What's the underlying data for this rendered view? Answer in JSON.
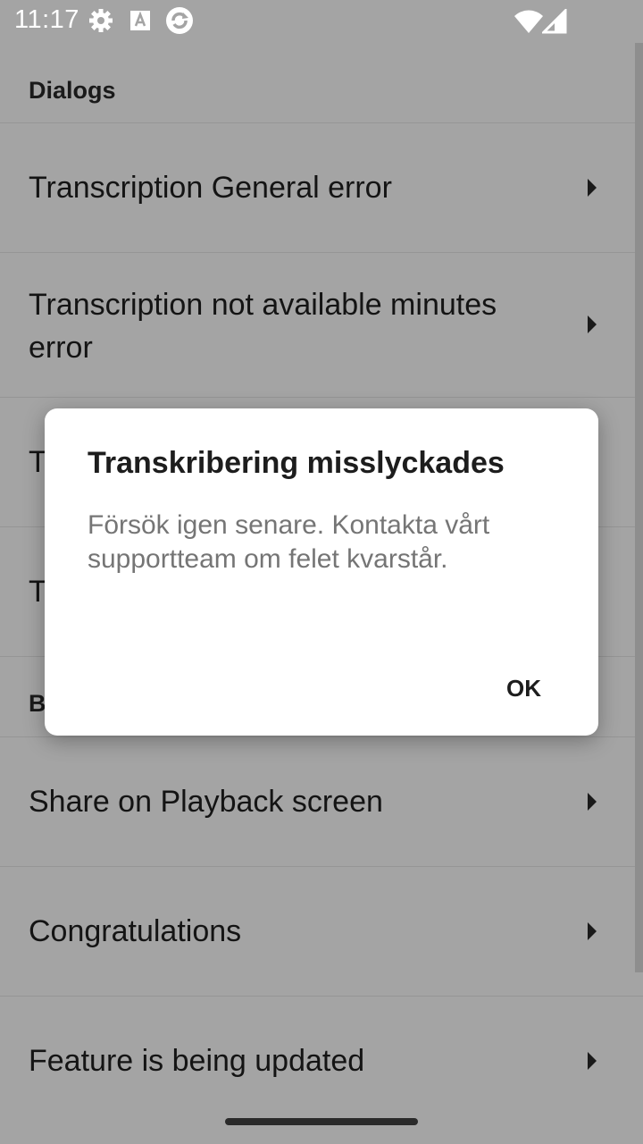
{
  "status_bar": {
    "time": "11:17",
    "icons": [
      "settings-icon",
      "accessibility-icon",
      "sync-icon",
      "wifi-icon",
      "signal-icon"
    ]
  },
  "list": {
    "sections": [
      {
        "header": "Dialogs"
      },
      {
        "header": "B"
      }
    ],
    "items": [
      {
        "label": "Transcription General error"
      },
      {
        "label": "Transcription not available minutes error"
      },
      {
        "label": "T"
      },
      {
        "label": "T"
      },
      {
        "label": "Share on Playback screen"
      },
      {
        "label": "Congratulations"
      },
      {
        "label": "Feature is being updated"
      }
    ]
  },
  "dialog": {
    "title": "Transkribering misslyckades",
    "message": "Försök igen senare. Kontakta vårt supportteam om felet kvarstår.",
    "ok_label": "OK"
  },
  "colors": {
    "scrim_background": "#a4a4a4",
    "dialog_background": "#ffffff",
    "message_text": "#757575"
  }
}
